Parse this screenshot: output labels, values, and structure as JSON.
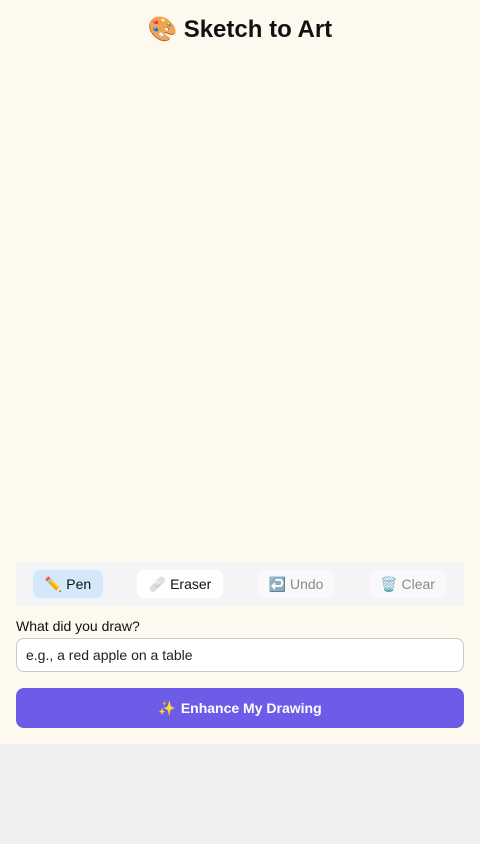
{
  "header": {
    "icon": "🎨",
    "icon_name": "palette-icon",
    "title": "Sketch to Art"
  },
  "toolbar": {
    "tools": [
      {
        "id": "pen",
        "icon": "✏️",
        "icon_name": "pencil-icon",
        "label": "Pen",
        "active": true,
        "enabled": true
      },
      {
        "id": "eraser",
        "icon": "🩹",
        "icon_name": "eraser-icon",
        "label": "Eraser",
        "active": false,
        "enabled": true
      },
      {
        "id": "undo",
        "icon": "↩️",
        "icon_name": "undo-icon",
        "label": "Undo",
        "active": false,
        "enabled": false
      },
      {
        "id": "clear",
        "icon": "🗑️",
        "icon_name": "trash-icon",
        "label": "Clear",
        "active": false,
        "enabled": false
      }
    ]
  },
  "prompt": {
    "label": "What did you draw?",
    "placeholder": "e.g., a red apple on a table",
    "value": ""
  },
  "action": {
    "icon": "✨",
    "icon_name": "sparkles-icon",
    "label": "Enhance My Drawing"
  },
  "colors": {
    "app_background": "#fef9ee",
    "page_background": "#f0f0f0",
    "accent": "#6c5ce7",
    "active_tool": "#d3e8fb"
  }
}
